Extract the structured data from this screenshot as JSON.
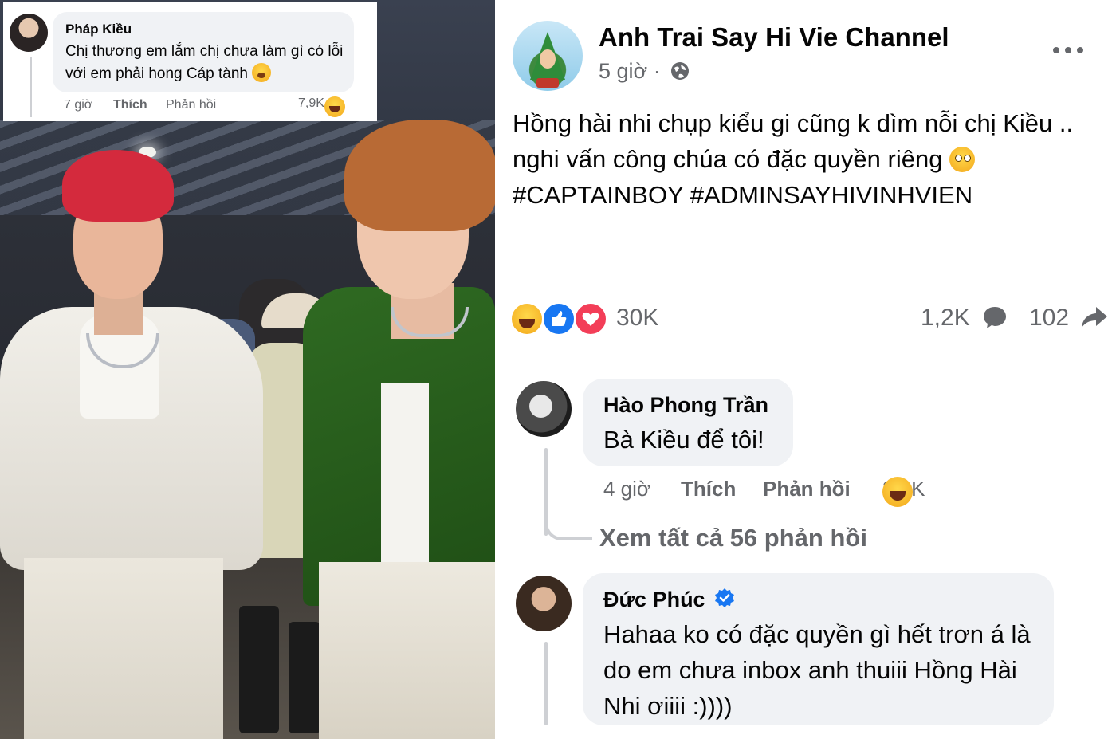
{
  "inset_comment": {
    "author": "Pháp Kiều",
    "text": "Chị thương em lắm chị chưa làm gì có lỗi với em phải hong Cáp tành",
    "time": "7 giờ",
    "like_label": "Thích",
    "reply_label": "Phản hồi",
    "reaction_count": "7,9K",
    "reaction_icon": "haha-icon"
  },
  "post": {
    "page_name": "Anh Trai Say Hi Vie Channel",
    "time": "5 giờ ·",
    "audience_icon": "globe-icon",
    "text_line1": "Hồng hài nhi chụp kiểu gi cũng k dìm nỗi chị Kiều ..",
    "text_line2": "nghi vấn công chúa có đặc quyền riêng",
    "tags": "#CAPTAINBOY #ADMINSAYHIVINHVIEN",
    "reactions": [
      "haha",
      "like",
      "love"
    ],
    "reaction_count": "30K",
    "comment_count": "1,2K",
    "share_count": "102",
    "colors": {
      "like": "#1877f2",
      "love": "#f33e58",
      "haha": "#f7b928",
      "meta": "#65676b"
    }
  },
  "comments": [
    {
      "author": "Hào Phong Trần",
      "text": "Bà Kiều để tôi!",
      "time": "4 giờ",
      "like_label": "Thích",
      "reply_label": "Phản hồi",
      "reaction_count": "3,9K",
      "view_replies": "Xem tất cả 56 phản hồi"
    },
    {
      "author": "Đức Phúc",
      "verified": true,
      "text": "Hahaa ko có đặc quyền gì hết trơn á là do em chưa inbox anh thuiii Hồng Hài Nhi ơiiii :))))"
    }
  ]
}
